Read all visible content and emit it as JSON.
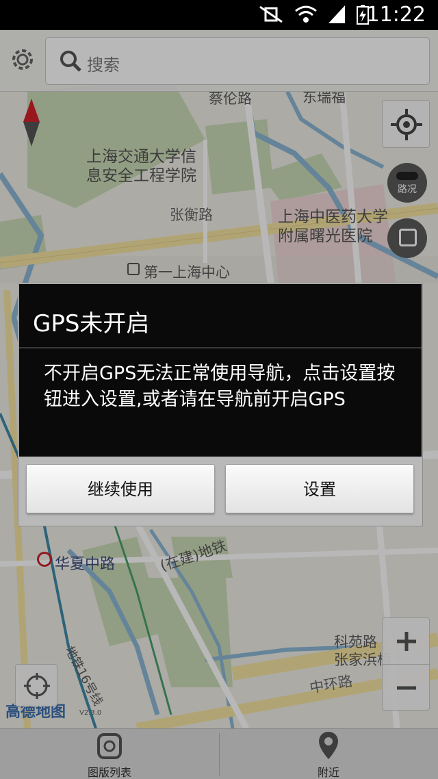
{
  "status_bar": {
    "time": "11:22",
    "icons": [
      "mute-vibrate-icon",
      "wifi-icon",
      "signal-icon",
      "battery-charging-icon"
    ]
  },
  "search": {
    "placeholder": "搜索"
  },
  "map": {
    "labels": {
      "cailun_rd": "蔡伦路",
      "dongruifu": "东瑞福",
      "sjtu_line1": "上海交通大学信",
      "sjtu_line2": "息安全工程学院",
      "zhangheng_rd": "张衡路",
      "tcm_line1": "上海中医药大学",
      "tcm_line2": "附属曙光医院",
      "first_center": "第一上海中心",
      "huaxia_rd": "华夏中路",
      "zaijian": "(在建)地铁",
      "keyuan_rd": "科苑路",
      "zhangjiabin": "张家浜桥",
      "zhonghuan_rd": "中环路",
      "metro16": "地铁16号线",
      "brand": "高德地图",
      "version": "V2.3.0"
    },
    "traffic_label": "路况"
  },
  "dialog": {
    "title": "GPS未开启",
    "message": "不开启GPS无法正常使用导航，点击设置按钮进入设置,或者请在导航前开启GPS",
    "continue_label": "继续使用",
    "settings_label": "设置"
  },
  "bottom_nav": {
    "layers_label": "图版列表",
    "nearby_label": "附近"
  },
  "colors": {
    "dialog_bg": "#0a0a0a",
    "metro_line": "#3f8aa8",
    "park": "#c9dcb5",
    "hospital": "#f1d8d8"
  }
}
